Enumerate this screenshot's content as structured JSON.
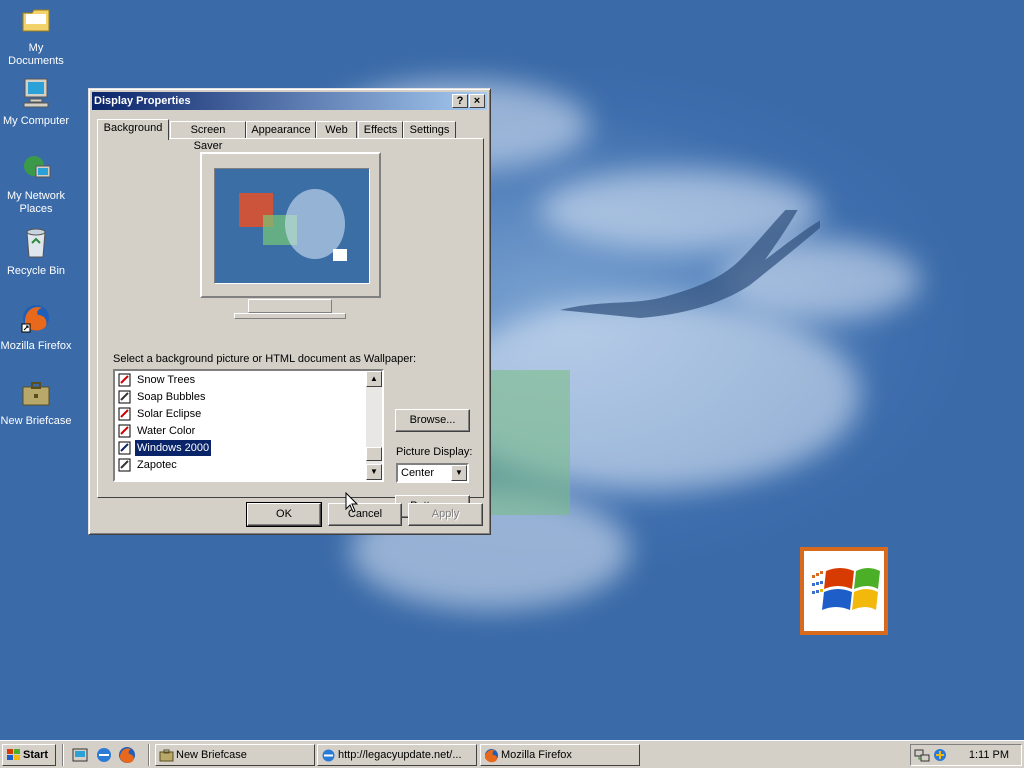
{
  "desktop": {
    "icons": [
      {
        "label": "My Documents"
      },
      {
        "label": "My Computer"
      },
      {
        "label": "My Network Places"
      },
      {
        "label": "Recycle Bin"
      },
      {
        "label": "Mozilla Firefox"
      },
      {
        "label": "New Briefcase"
      }
    ]
  },
  "dialog": {
    "title": "Display Properties",
    "help_btn": "?",
    "close_btn": "×",
    "tabs": [
      {
        "label": "Background"
      },
      {
        "label": "Screen Saver"
      },
      {
        "label": "Appearance"
      },
      {
        "label": "Web"
      },
      {
        "label": "Effects"
      },
      {
        "label": "Settings"
      }
    ],
    "active_tab": "Background",
    "wallpaper_label": "Select a background picture or HTML document as Wallpaper:",
    "wallpapers": [
      {
        "label": "Snow Trees"
      },
      {
        "label": "Soap Bubbles"
      },
      {
        "label": "Solar Eclipse"
      },
      {
        "label": "Water Color"
      },
      {
        "label": "Windows 2000"
      },
      {
        "label": "Zapotec"
      }
    ],
    "selected_wallpaper": "Windows 2000",
    "browse_btn": "Browse...",
    "picture_display_label": "Picture Display:",
    "picture_display_value": "Center",
    "pattern_btn": "Pattern...",
    "ok_btn": "OK",
    "cancel_btn": "Cancel",
    "apply_btn": "Apply"
  },
  "taskbar": {
    "start_label": "Start",
    "tasks": [
      {
        "label": "New Briefcase"
      },
      {
        "label": "http://legacyupdate.net/..."
      },
      {
        "label": "Mozilla Firefox"
      }
    ],
    "clock": "1:11 PM"
  },
  "colors": {
    "desktop": "#3a6ea5",
    "titlebar_start": "#0a246a",
    "titlebar_end": "#a6caf0",
    "face": "#d4d0c8",
    "selection": "#0a246a"
  }
}
